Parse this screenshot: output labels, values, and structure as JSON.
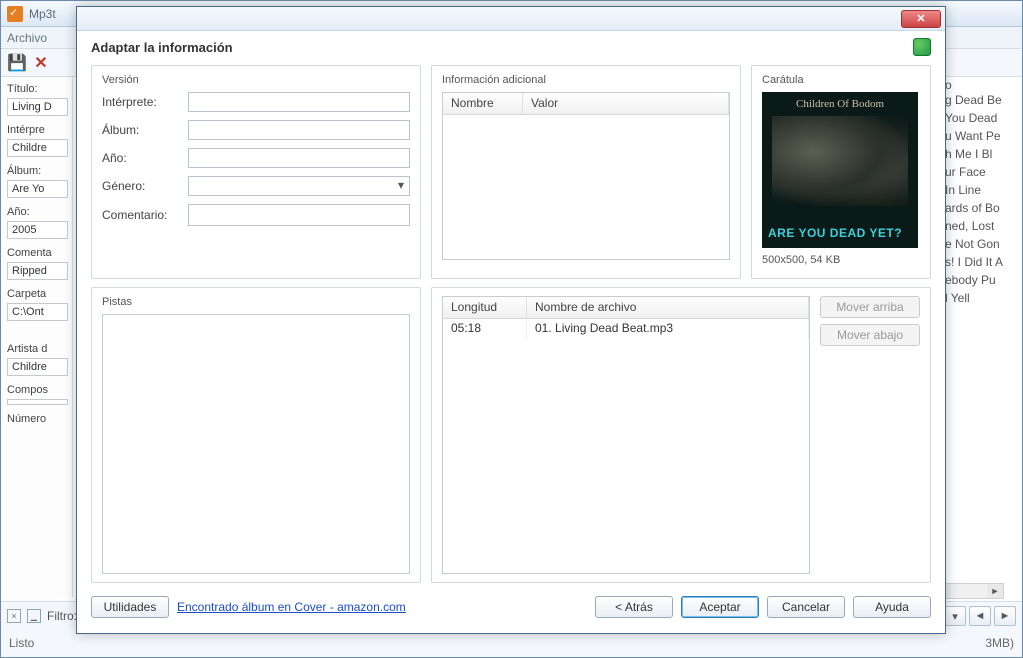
{
  "bg": {
    "app_title": "Mp3t",
    "menu_archivo": "Archivo",
    "left": {
      "titulo_lbl": "Título:",
      "titulo_val": "Living D",
      "interprete_lbl": "Intérpre",
      "interprete_val": "Childre",
      "album_lbl": "Álbum:",
      "album_val": "Are Yo",
      "ano_lbl": "Año:",
      "ano_val": "2005",
      "comentario_lbl": "Comenta",
      "comentario_val": "Ripped",
      "carpeta_lbl": "Carpeta",
      "carpeta_val": "C:\\Ont",
      "artista_lbl": "Artista d",
      "artista_val": "Childre",
      "compositor_lbl": "Compos",
      "compositor_val": "",
      "numero_lbl": "Número"
    },
    "right_header": "o",
    "right_list": [
      "g Dead Be",
      "You Dead",
      "u Want Pe",
      "h Me I Bl",
      "ur Face",
      "In Line",
      "ards of Bo",
      "ned, Lost",
      "e Not Gon",
      "s! I Did It A",
      "ebody Pu",
      "l Yell"
    ],
    "filtro_lbl": "Filtro:",
    "status_left": "Listo",
    "status_right": "3MB)",
    "close_x": "×"
  },
  "dlg": {
    "title": "Adaptar la información",
    "version_legend": "Versión",
    "interprete_lbl": "Intérprete:",
    "interprete_val": "",
    "album_lbl": "Álbum:",
    "album_val": "",
    "ano_lbl": "Año:",
    "ano_val": "",
    "genero_lbl": "Género:",
    "genero_val": "",
    "comentario_lbl": "Comentario:",
    "comentario_val": "",
    "addinfo_legend": "Información adicional",
    "addinfo_col1": "Nombre",
    "addinfo_col2": "Valor",
    "cover_legend": "Carátula",
    "cover_band": "Children Of Bodom",
    "cover_title": "ARE YOU DEAD YET?",
    "cover_info": "500x500, 54 KB",
    "tracks_legend": "Pistas",
    "tracks_col1": "Longitud",
    "tracks_col2": "Nombre de archivo",
    "track_len": "05:18",
    "track_file": "01. Living Dead Beat.mp3",
    "move_up": "Mover arriba",
    "move_down": "Mover abajo",
    "utilidades": "Utilidades",
    "found_link": "Encontrado álbum en Cover - amazon.com",
    "back": "< Atrás",
    "accept": "Aceptar",
    "cancel": "Cancelar",
    "help": "Ayuda"
  }
}
